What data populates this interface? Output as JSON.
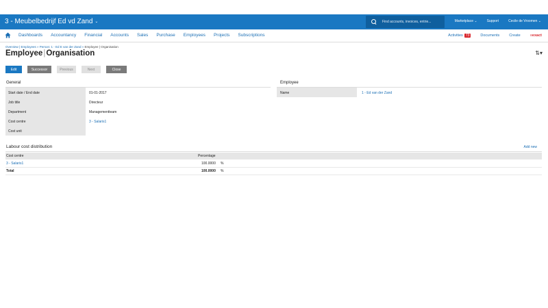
{
  "topbar": {
    "company": "3 - Meubelbedrijf Ed vd Zand",
    "search_placeholder": "Find accounts, invoices, entrie...",
    "links": [
      "Marketplace ⌄",
      "Support",
      "Cecile de Vroomen ⌄"
    ]
  },
  "nav": {
    "items": [
      "Dashboards",
      "Accountancy",
      "Financial",
      "Accounts",
      "Sales",
      "Purchase",
      "Employees",
      "Projects",
      "Subscriptions"
    ],
    "activities_label": "Activities",
    "activities_count": "73",
    "documents": "Documents",
    "create": "Create",
    "brand": "≡exact"
  },
  "breadcrumb": {
    "links": [
      "Overview",
      "Employees",
      "Person: 1 - Ed E van der Zand"
    ],
    "current": "Employee | Organisation"
  },
  "page": {
    "title_main": "Employee",
    "title_sep": "|",
    "title_sub": "Organisation"
  },
  "buttons": {
    "edit": "Edit",
    "successor": "Successor",
    "previous": "Previous",
    "next": "Next",
    "close": "Close"
  },
  "general": {
    "title": "General",
    "rows": [
      {
        "label": "Start date / End date",
        "value": "01-01-2017"
      },
      {
        "label": "Job title",
        "value": "Directeur"
      },
      {
        "label": "Department",
        "value": "Managementteam"
      },
      {
        "label": "Cost centre",
        "value": "3 - Salaris1"
      },
      {
        "label": "Cost unit",
        "value": ""
      }
    ]
  },
  "employee": {
    "title": "Employee",
    "name_label": "Name",
    "name_value": "1 - Ed van der Zand"
  },
  "labour": {
    "title": "Labour cost distribution",
    "add_new": "Add new",
    "col_cost_centre": "Cost centre",
    "col_percentage": "Percentage",
    "rows": [
      {
        "cost_centre": "3 - Salaris1",
        "percentage": "100.0000",
        "unit": "%"
      }
    ],
    "total_label": "Total",
    "total_value": "100.0000",
    "total_unit": "%"
  }
}
